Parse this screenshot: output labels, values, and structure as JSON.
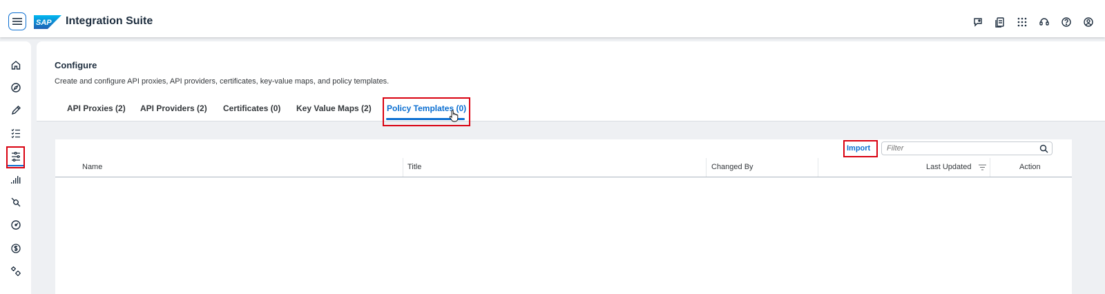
{
  "shell": {
    "logo_text": "SAP",
    "title": "Integration Suite",
    "action_icons": [
      "feedback-icon",
      "notes-icon",
      "app-grid-icon",
      "support-icon",
      "help-icon",
      "user-icon"
    ]
  },
  "sidebar": {
    "items": [
      {
        "icon": "home-icon"
      },
      {
        "icon": "discover-icon"
      },
      {
        "icon": "design-icon"
      },
      {
        "icon": "test-icon"
      },
      {
        "icon": "configure-icon",
        "active": true
      },
      {
        "icon": "monitor-icon"
      },
      {
        "icon": "connectivity-icon"
      },
      {
        "icon": "dashboard-icon"
      },
      {
        "icon": "monetize-icon"
      },
      {
        "icon": "settings-icon"
      }
    ]
  },
  "page": {
    "title": "Configure",
    "description": "Create and configure API proxies, API providers, certificates, key-value maps, and policy templates."
  },
  "tabs": [
    {
      "label": "API Proxies (2)"
    },
    {
      "label": "API Providers (2)"
    },
    {
      "label": "Certificates (0)"
    },
    {
      "label": "Key Value Maps (2)"
    },
    {
      "label": "Policy Templates (0)",
      "selected": true
    }
  ],
  "table": {
    "import_label": "Import",
    "filter_placeholder": "Filter",
    "columns": [
      "Name",
      "Title",
      "Changed By",
      "Last Updated",
      "Action"
    ],
    "rows": []
  },
  "colors": {
    "accent": "#0a6ed1",
    "highlight": "#d9000f",
    "shell_bg": "#ffffff",
    "page_bg": "#eef0f3"
  }
}
